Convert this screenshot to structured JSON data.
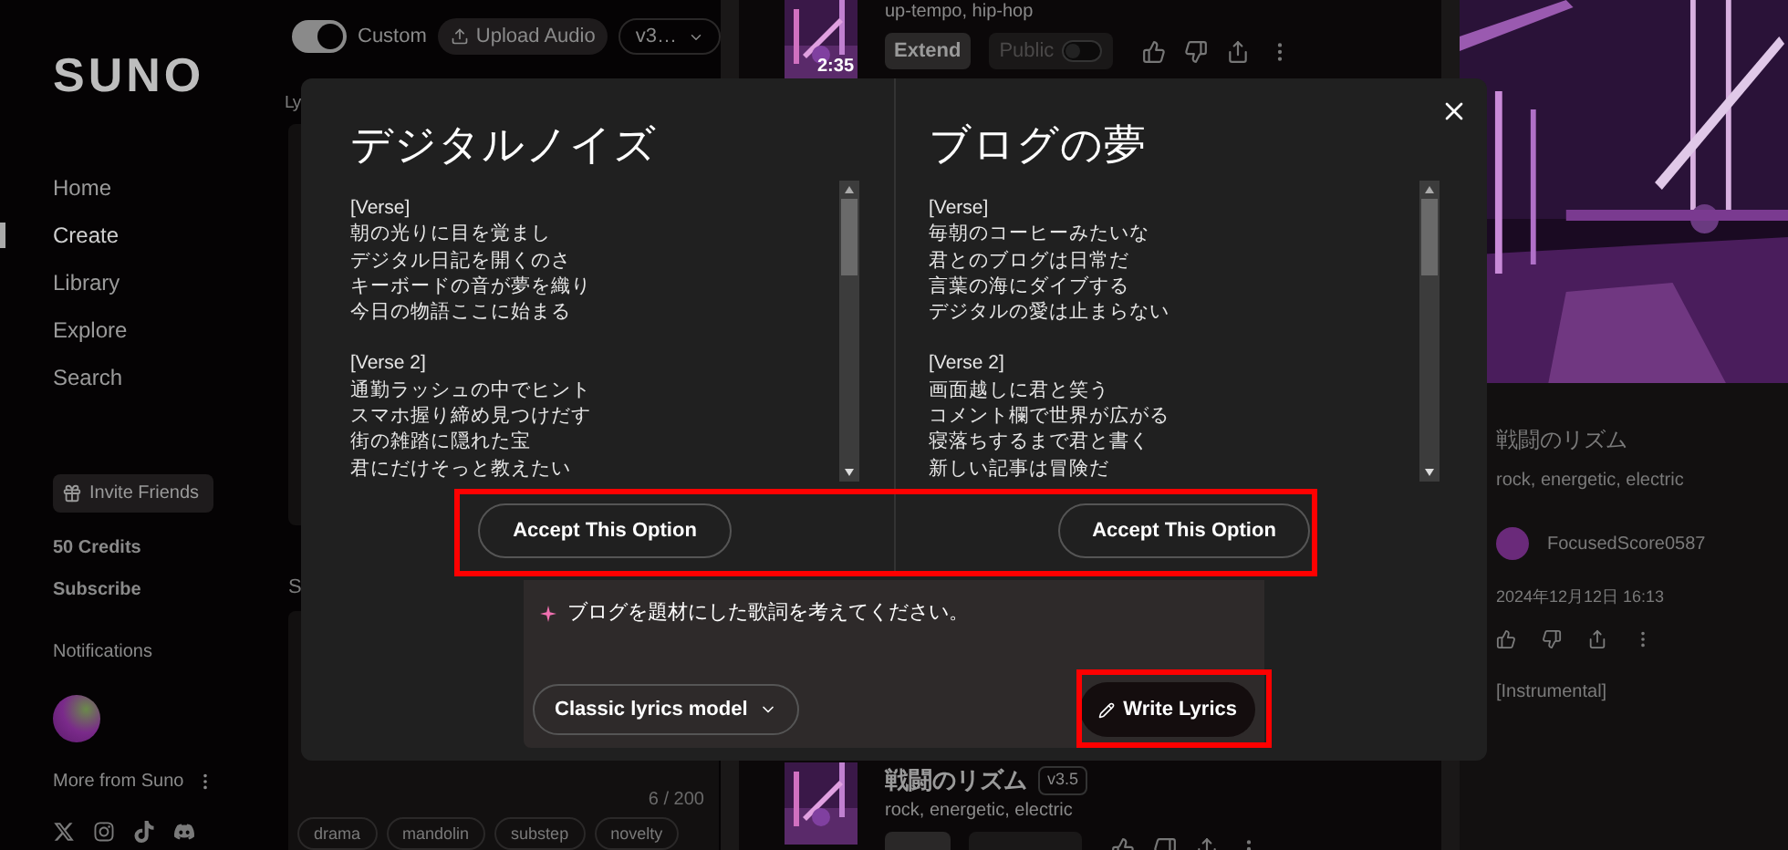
{
  "sidebar": {
    "logo": "SUNO",
    "nav": [
      {
        "label": "Home",
        "selected": false
      },
      {
        "label": "Create",
        "selected": true
      },
      {
        "label": "Library",
        "selected": false
      },
      {
        "label": "Explore",
        "selected": false
      },
      {
        "label": "Search",
        "selected": false
      }
    ],
    "invite_button": "Invite Friends",
    "credits": "50 Credits",
    "subscribe": "Subscribe",
    "notifications": "Notifications",
    "more": "More from Suno"
  },
  "create_panel": {
    "custom_toggle": {
      "label": "Custom",
      "on": true
    },
    "upload_button": "Upload Audio",
    "version_select": "v3…",
    "section_label": "Ly",
    "section_label_2": "S",
    "char_count": "6 / 200",
    "tags": [
      "drama",
      "mandolin",
      "substep",
      "novelty"
    ]
  },
  "songs": [
    {
      "duration": "2:35",
      "tags": "up-tempo, hip-hop",
      "extend": "Extend",
      "public": {
        "label": "Public",
        "on": false
      }
    },
    {
      "title": "戦闘のリズム",
      "version": "v3.5",
      "tags": "rock, energetic, electric"
    }
  ],
  "detail": {
    "title": "戦闘のリズム",
    "tags": "rock, energetic, electric",
    "user": "FocusedScore0587",
    "date": "2024年12月12日 16:13",
    "lyrics": "[Instrumental]"
  },
  "modal": {
    "options": [
      {
        "title": "デジタルノイズ",
        "sections": [
          {
            "heading": "[Verse]",
            "lines": [
              "朝の光りに目を覚まし",
              "デジタル日記を開くのさ",
              "キーボードの音が夢を織り",
              "今日の物語ここに始まる"
            ]
          },
          {
            "heading": "[Verse 2]",
            "lines": [
              "通勤ラッシュの中でヒント",
              "スマホ握り締め見つけだす",
              "街の雑踏に隠れた宝",
              "君にだけそっと教えたい"
            ]
          }
        ],
        "accept": "Accept This Option"
      },
      {
        "title": "ブログの夢",
        "sections": [
          {
            "heading": "[Verse]",
            "lines": [
              "毎朝のコーヒーみたいな",
              "君とのブログは日常だ",
              "言葉の海にダイブする",
              "デジタルの愛は止まらない"
            ]
          },
          {
            "heading": "[Verse 2]",
            "lines": [
              "画面越しに君と笑う",
              "コメント欄で世界が広がる",
              "寝落ちするまで君と書く",
              "新しい記事は冒険だ"
            ]
          }
        ],
        "accept": "Accept This Option"
      }
    ],
    "accept_highlighted": true,
    "prompt": "ブログを題材にした歌詞を考えてください。",
    "model_select": "Classic lyrics model",
    "write_button": {
      "label": "Write Lyrics",
      "highlighted": true
    }
  }
}
